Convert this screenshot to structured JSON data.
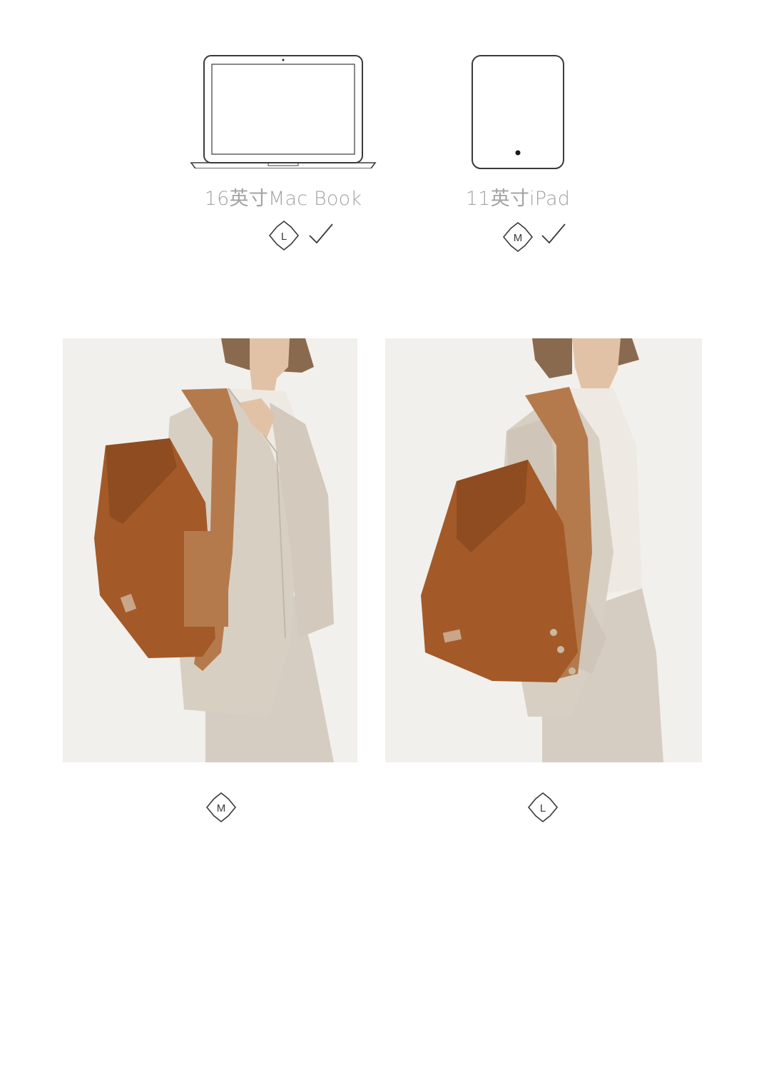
{
  "devices": [
    {
      "label": "16英寸Mac Book",
      "size": "L",
      "fits": true,
      "icon": "laptop-icon"
    },
    {
      "label": "11英寸iPad",
      "size": "M",
      "fits": true,
      "icon": "tablet-icon"
    }
  ],
  "photos": [
    {
      "size": "M",
      "icon": "size-m-badge"
    },
    {
      "size": "L",
      "icon": "size-l-badge"
    }
  ],
  "colors": {
    "line": "#3a3a3a",
    "label": "#a3a3a3",
    "bag_suede": "#a35a28",
    "bag_leather": "#b57a4c",
    "blazer": "#d8cfc3",
    "background": "#f2f0ec"
  }
}
